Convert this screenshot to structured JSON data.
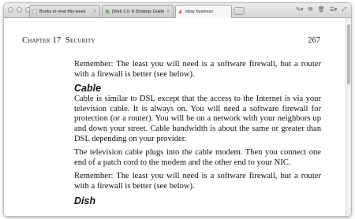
{
  "browser": {
    "tabs": [
      {
        "title": "Books to read this week",
        "icon": "bookmark-icon",
        "active": false
      },
      {
        "title": "[Web 2.0: A Strategy Guide",
        "icon": "web-page-icon",
        "active": false
      },
      {
        "title": "ebay business",
        "icon": "pdf-icon",
        "active": true
      }
    ],
    "toolbar_icons": [
      "pencil-icon",
      "tools-icon",
      "trash-icon",
      "list-menu-icon",
      "fullscreen-icon"
    ]
  },
  "document": {
    "running_head": {
      "chapter": "Chapter 17",
      "section": "Security",
      "page_number": "267"
    },
    "blocks": [
      {
        "type": "p",
        "text": "Remember: The least you will need is a software firewall, but a router with a firewall is better (see below)."
      },
      {
        "type": "h",
        "text": "Cable"
      },
      {
        "type": "p",
        "text": "Cable is similar to DSL except that the access to the Internet is via your television cable. It is always on. You will need a software firewall for protection (or a router). You will be on a network with your neighbors up and down your street. Cable bandwidth is about the same or greater than DSL depending on your provider."
      },
      {
        "type": "p",
        "text": "The television cable plugs into the cable modem. Then you connect one end of a patch cord to the modem and the other end to your NIC."
      },
      {
        "type": "p",
        "text": "Remember: The least you will need is a software firewall, but a router with a firewall is better (see below)."
      },
      {
        "type": "h",
        "text": "Dish"
      }
    ]
  },
  "colors": {
    "pdf_red": "#c8262b",
    "web_green": "#3f9a3a",
    "page_bg": "#ffffff"
  }
}
